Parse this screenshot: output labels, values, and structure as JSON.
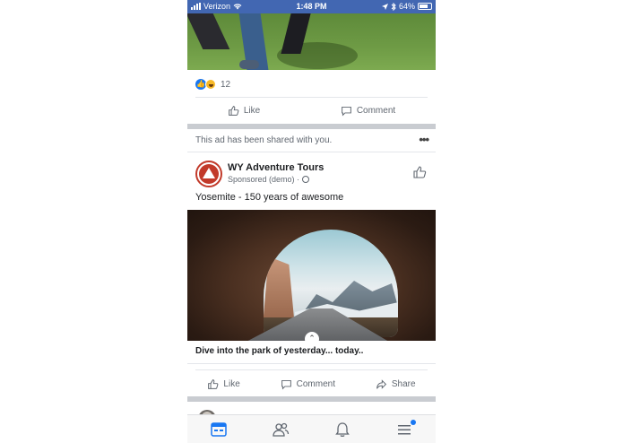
{
  "status_bar": {
    "carrier": "Verizon",
    "time": "1:48 PM",
    "battery": "64%"
  },
  "previous_post": {
    "reaction_count": "12",
    "actions": {
      "like": "Like",
      "comment": "Comment"
    }
  },
  "ad_post": {
    "shared_notice": "This ad has been shared with you.",
    "more_label": "•••",
    "page_name": "WY Adventure Tours",
    "sponsored_label": "Sponsored (demo) ·",
    "caption": "Yosemite - 150 years of awesome",
    "link_description": "Dive into the park of yesterday... today..",
    "actions": {
      "like": "Like",
      "comment": "Comment",
      "share": "Share"
    }
  },
  "tab_bar": {
    "tabs": [
      {
        "icon": "news-feed-icon",
        "active": true
      },
      {
        "icon": "friends-icon",
        "active": false
      },
      {
        "icon": "notifications-bell-icon",
        "active": false
      },
      {
        "icon": "menu-icon",
        "active": false,
        "badge": true
      }
    ]
  },
  "colors": {
    "brand_blue": "#4267b2",
    "accent_blue": "#1877f2",
    "text_secondary": "#606770",
    "avatar_red": "#c23a2a"
  }
}
